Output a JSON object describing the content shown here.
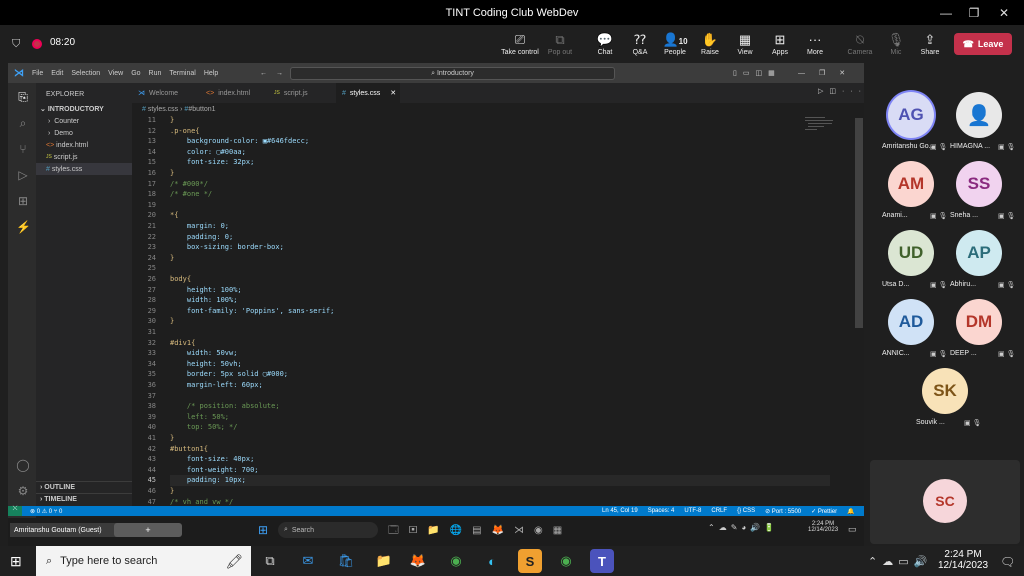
{
  "teams": {
    "title": "TINT Coding Club WebDev",
    "time": "08:20",
    "toolbar": [
      {
        "label": "Take control",
        "icon": "take-control-icon"
      },
      {
        "label": "Pop out",
        "icon": "pop-out-icon"
      },
      {
        "label": "Chat",
        "icon": "chat-icon"
      },
      {
        "label": "Q&A",
        "icon": "qa-icon"
      },
      {
        "label": "People",
        "icon": "people-icon",
        "count": "10"
      },
      {
        "label": "Raise",
        "icon": "raise-hand-icon"
      },
      {
        "label": "View",
        "icon": "view-icon"
      },
      {
        "label": "Apps",
        "icon": "apps-icon"
      },
      {
        "label": "More",
        "icon": "more-icon"
      },
      {
        "label": "Camera",
        "icon": "camera-icon"
      },
      {
        "label": "Mic",
        "icon": "mic-icon"
      },
      {
        "label": "Share",
        "icon": "share-icon"
      }
    ],
    "leave_label": "Leave",
    "participants": [
      {
        "initials": "AG",
        "name": "Amritanshu Go...",
        "bg": "#d9dcf5",
        "fg": "#4f52b2"
      },
      {
        "initials": "",
        "name": "HIMAGNA ...",
        "bg": "#e8e8e8",
        "fg": "#333"
      },
      {
        "initials": "AM",
        "name": "Anami...",
        "bg": "#fbd6d0",
        "fg": "#b4362a"
      },
      {
        "initials": "SS",
        "name": "Sneha ...",
        "bg": "#f1d3ef",
        "fg": "#8a2a7f"
      },
      {
        "initials": "UD",
        "name": "Utsa D...",
        "bg": "#dbe6d3",
        "fg": "#40612b"
      },
      {
        "initials": "AP",
        "name": "Abhiru...",
        "bg": "#cfeaf0",
        "fg": "#2c6d7a"
      },
      {
        "initials": "AD",
        "name": "ANNIC...",
        "bg": "#d0e2f6",
        "fg": "#1f5a9b"
      },
      {
        "initials": "DM",
        "name": "DEEP ...",
        "bg": "#fbd6d0",
        "fg": "#b4362a"
      },
      {
        "initials": "SK",
        "name": "Souvik ...",
        "bg": "#f8e2b8",
        "fg": "#7d5418"
      }
    ],
    "self_initials": "SC",
    "presenter_label": "Amritanshu Goutam (Guest)"
  },
  "vscode": {
    "menu": [
      "File",
      "Edit",
      "Selection",
      "View",
      "Go",
      "Run",
      "Terminal",
      "Help"
    ],
    "search": "Introductory",
    "explorer_title": "EXPLORER",
    "folder": "INTRODUCTORY",
    "tree": [
      "Counter",
      "Demo",
      "index.html",
      "script.js",
      "styles.css"
    ],
    "outline": "OUTLINE",
    "timeline": "TIMELINE",
    "tabs": [
      "Welcome",
      "index.html",
      "script.js",
      "styles.css"
    ],
    "breadcrumb": [
      "styles.css",
      "#button1"
    ],
    "lines": [
      {
        "n": "11",
        "t": "}"
      },
      {
        "n": "12",
        "t": ".p-one{"
      },
      {
        "n": "13",
        "t": "    background-color: ▣#646fdecc;"
      },
      {
        "n": "14",
        "t": "    color: ▢#00aa;"
      },
      {
        "n": "15",
        "t": "    font-size: 32px;"
      },
      {
        "n": "16",
        "t": "}"
      },
      {
        "n": "17",
        "t": "/* #000*/"
      },
      {
        "n": "18",
        "t": "/* #one */"
      },
      {
        "n": "19",
        "t": ""
      },
      {
        "n": "20",
        "t": "*{"
      },
      {
        "n": "21",
        "t": "    margin: 0;"
      },
      {
        "n": "22",
        "t": "    padding: 0;"
      },
      {
        "n": "23",
        "t": "    box-sizing: border-box;"
      },
      {
        "n": "24",
        "t": "}"
      },
      {
        "n": "25",
        "t": ""
      },
      {
        "n": "26",
        "t": "body{"
      },
      {
        "n": "27",
        "t": "    height: 100%;"
      },
      {
        "n": "28",
        "t": "    width: 100%;"
      },
      {
        "n": "29",
        "t": "    font-family: 'Poppins', sans-serif;"
      },
      {
        "n": "30",
        "t": "}"
      },
      {
        "n": "31",
        "t": ""
      },
      {
        "n": "32",
        "t": "#div1{"
      },
      {
        "n": "33",
        "t": "    width: 50vw;"
      },
      {
        "n": "34",
        "t": "    height: 50vh;"
      },
      {
        "n": "35",
        "t": "    border: 5px solid ▢#000;"
      },
      {
        "n": "36",
        "t": "    margin-left: 60px;"
      },
      {
        "n": "37",
        "t": ""
      },
      {
        "n": "38",
        "t": "    /* position: absolute;"
      },
      {
        "n": "39",
        "t": "    left: 50%;"
      },
      {
        "n": "40",
        "t": "    top: 50%; */"
      },
      {
        "n": "41",
        "t": "}"
      },
      {
        "n": "42",
        "t": "#button1{"
      },
      {
        "n": "43",
        "t": "    font-size: 40px;"
      },
      {
        "n": "44",
        "t": "    font-weight: 700;"
      },
      {
        "n": "45",
        "t": "    padding: 10px;"
      },
      {
        "n": "46",
        "t": "}"
      },
      {
        "n": "47",
        "t": "/* vh and vw */"
      }
    ],
    "status_left": "⊗ 0 ⚠ 0   ⑂ 0",
    "status_right": [
      "Ln 45, Col 19",
      "Spaces: 4",
      "UTF-8",
      "CRLF",
      "{} CSS",
      "⊘ Port : 5500",
      "✓ Prettier"
    ],
    "inner_clock_time": "2:24 PM",
    "inner_clock_date": "12/14/2023",
    "inner_search": "Search"
  },
  "windows": {
    "search_placeholder": "Type here to search",
    "time": "2:24 PM",
    "date": "12/14/2023"
  }
}
